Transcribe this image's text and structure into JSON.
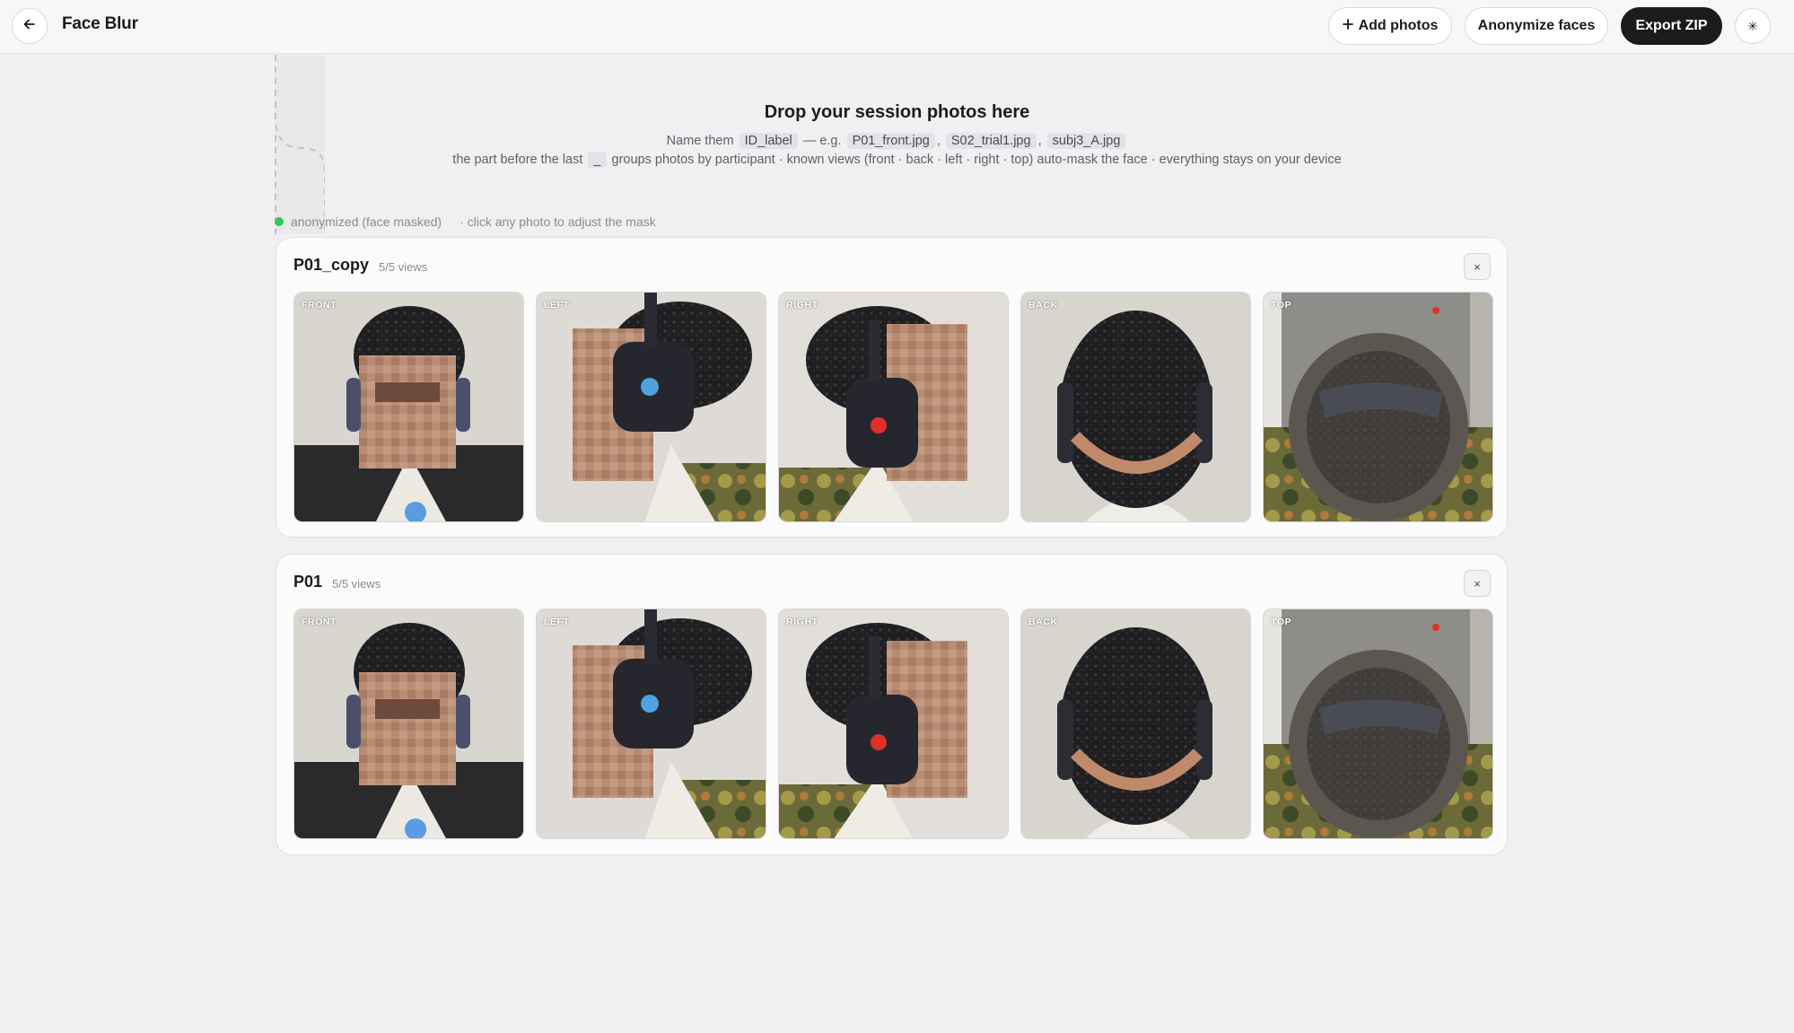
{
  "header": {
    "title": "Face Blur",
    "add_photos_label": "Add photos",
    "anonymize_label": "Anonymize faces",
    "export_label": "Export ZIP",
    "theme_icon": "✳"
  },
  "dropzone": {
    "title": "Drop your session photos here",
    "line1_prefix": "Name them",
    "line1_code": "ID_label",
    "line1_eg": "— e.g.",
    "examples": [
      "P01_front.jpg",
      "S02_trial1.jpg",
      "subj3_A.jpg"
    ],
    "comma": ",",
    "line2_prefix": "the part before the last",
    "line2_code": "_",
    "line2_suffix": "groups photos by participant · known views (front · back · left · right · top) auto-mask the face · everything stays on your device"
  },
  "status": {
    "legend": "anonymized (face masked)",
    "hint": "· click any photo to adjust the mask",
    "dot_color": "#34c759"
  },
  "groups": [
    {
      "name": "P01_copy",
      "count": "5/5 views",
      "close": "×",
      "views": [
        "FRONT",
        "LEFT",
        "RIGHT",
        "BACK",
        "TOP"
      ]
    },
    {
      "name": "P01",
      "count": "5/5 views",
      "close": "×",
      "views": [
        "FRONT",
        "LEFT",
        "RIGHT",
        "BACK",
        "TOP"
      ]
    }
  ]
}
